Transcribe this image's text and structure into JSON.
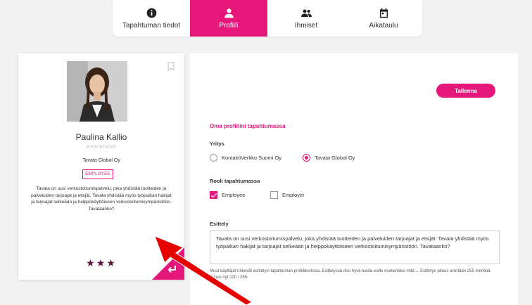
{
  "tabs": [
    {
      "label": "Tapahtuman tiedot",
      "icon": "info-icon",
      "active": false
    },
    {
      "label": "Profiili",
      "icon": "person-icon",
      "active": true
    },
    {
      "label": "Ihmiset",
      "icon": "people-icon",
      "active": false
    },
    {
      "label": "Aikataulu",
      "icon": "calendar-icon",
      "active": false
    }
  ],
  "card": {
    "name": "Paulina Kallio",
    "title": "ASSISTANT",
    "company": "Tavata Global Oy",
    "badge": "EMPLOYEE",
    "bio": "Tavata on uusi verkostoitumispalvelu, joka yhdistää tuotteiden ja palveluiden tarjoajat ja etsijät. Tavata yhdistää myös työpaikan hakijat ja tarjoajat selkeään ja helppokäyttöiseen verkostoitumisympäristöön. Tavataanko?",
    "stars": "★★★"
  },
  "form": {
    "save_label": "Tallenna",
    "section_title": "Oma profiilini tapahtumassa",
    "company_label": "Yritys",
    "company_options": [
      "KontaktiVerkko Suomi Oy",
      "Tavata Global Oy"
    ],
    "company_selected": "Tavata Global Oy",
    "role_label": "Rooli tapahtumassa",
    "role_options": [
      "Employee",
      "Employer"
    ],
    "role_checked": [
      "Employee"
    ],
    "intro_label": "Esittely",
    "intro_value": "Tavata on uusi verkostoitumispalvelu, joka yhdistää tuotteiden ja palveluiden tarjoajat ja etsijät. Tavata yhdistää myös työpaikan hakijat ja tarjoajat selkeään ja helppokäyttöiseen verkostoitumisympäristöön. Tavataanko?",
    "help_text": "Muut käyttäjät näkevät esittelysi tapahtuman profiilikortissa. Esittelyssä olisi hyvä tuoda esille esimerkiksi mitä ... Esittelyn pituus enintään 255 merkkiä. Pituus nyt 220 / 255."
  },
  "colors": {
    "accent": "#e6177b",
    "stars": "#5b1440",
    "arrow": "#e60000"
  }
}
